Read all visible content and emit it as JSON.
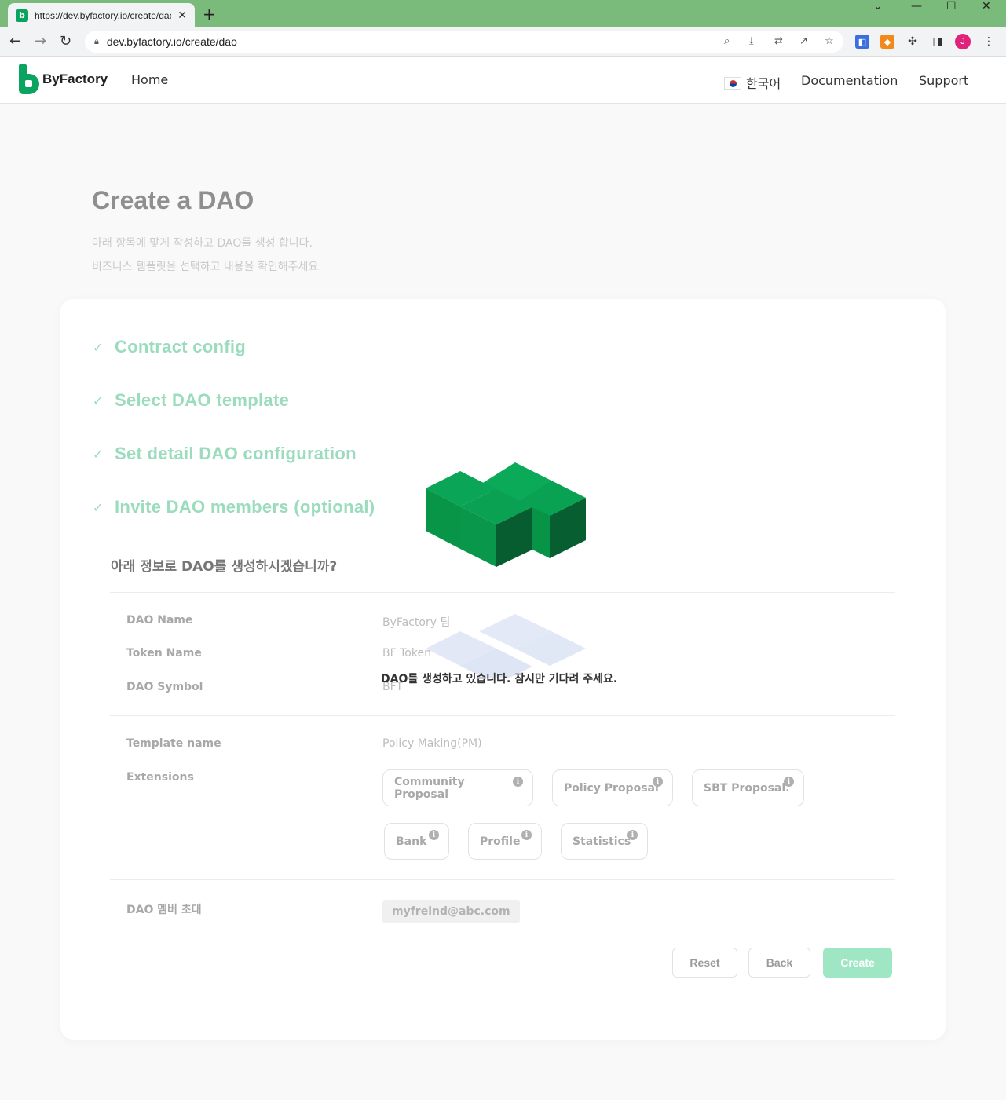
{
  "browser": {
    "tab_title": "https://dev.byfactory.io/create/dao",
    "url": "dev.byfactory.io/create/dao",
    "profile_initial": "J"
  },
  "header": {
    "logo_text": "ByFactory",
    "nav_home": "Home",
    "language": "한국어",
    "documentation": "Documentation",
    "support": "Support"
  },
  "page": {
    "title": "Create a DAO",
    "subtitle_line1": "아래 항목에 맞게 작성하고 DAO를 생성 합니다.",
    "subtitle_line2": "비즈니스 템플릿을 선택하고 내용을 확인해주세요."
  },
  "steps": [
    {
      "label": "Contract config",
      "done": true
    },
    {
      "label": "Select DAO template",
      "done": true
    },
    {
      "label": "Set detail DAO configuration",
      "done": true
    },
    {
      "label": "Invite DAO members (optional)",
      "done": true
    }
  ],
  "summary": {
    "question": "아래 정보로 DAO를 생성하시겠습니까?",
    "dao_name_label": "DAO Name",
    "dao_name_value": "ByFactory 팀",
    "token_name_label": "Token Name",
    "token_name_value": "BF Token",
    "dao_symbol_label": "DAO Symbol",
    "dao_symbol_value": "BFT",
    "template_label": "Template name",
    "template_value": "Policy Making(PM)",
    "extensions_label": "Extensions",
    "extensions": [
      "Community Proposal",
      "Policy Proposal",
      "SBT Proposal.",
      "Bank",
      "Profile",
      "Statistics"
    ],
    "members_label": "DAO 멤버 초대",
    "members": [
      "myfreind@abc.com"
    ]
  },
  "buttons": {
    "reset": "Reset",
    "back": "Back",
    "create": "Create"
  },
  "loading": {
    "message": "DAO를 생성하고 있습니다. 잠시만 기다려 주세요."
  },
  "colors": {
    "brand_green": "#0ba360",
    "step_done": "#9adcbd",
    "create_button": "#9fe6c5"
  }
}
